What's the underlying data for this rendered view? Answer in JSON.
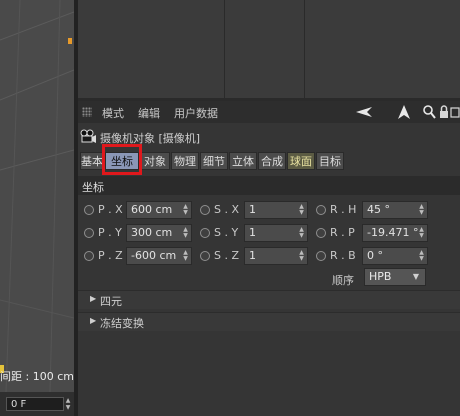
{
  "viewport": {
    "status_text": "间距 : 100 cm",
    "frame_value": "0 F"
  },
  "menu": {
    "items": [
      "模式",
      "编辑",
      "用户数据"
    ]
  },
  "object": {
    "title": "摄像机对象 [摄像机]"
  },
  "tabs": [
    {
      "label": "基本",
      "state": "normal"
    },
    {
      "label": "坐标",
      "state": "active"
    },
    {
      "label": "对象",
      "state": "normal"
    },
    {
      "label": "物理",
      "state": "normal"
    },
    {
      "label": "细节",
      "state": "normal"
    },
    {
      "label": "立体",
      "state": "normal"
    },
    {
      "label": "合成",
      "state": "normal"
    },
    {
      "label": "球面",
      "state": "highlight"
    },
    {
      "label": "目标",
      "state": "normal"
    }
  ],
  "section": {
    "title": "坐标"
  },
  "coords": {
    "position": [
      {
        "label": "P . X",
        "value": "600 cm"
      },
      {
        "label": "P . Y",
        "value": "300 cm"
      },
      {
        "label": "P . Z",
        "value": "-600 cm"
      }
    ],
    "scale": [
      {
        "label": "S . X",
        "value": "1"
      },
      {
        "label": "S . Y",
        "value": "1"
      },
      {
        "label": "S . Z",
        "value": "1"
      }
    ],
    "rotation": [
      {
        "label": "R . H",
        "value": "45 °"
      },
      {
        "label": "R . P",
        "value": "-19.471 °"
      },
      {
        "label": "R . B",
        "value": "0 °"
      }
    ]
  },
  "order": {
    "label": "顺序",
    "value": "HPB"
  },
  "groups": [
    {
      "label": "四元"
    },
    {
      "label": "冻结变换"
    }
  ],
  "colors": {
    "active_tab": "#8a97b6",
    "highlight_tab": "#5b5b43",
    "annotation_box": "#e0181c"
  }
}
